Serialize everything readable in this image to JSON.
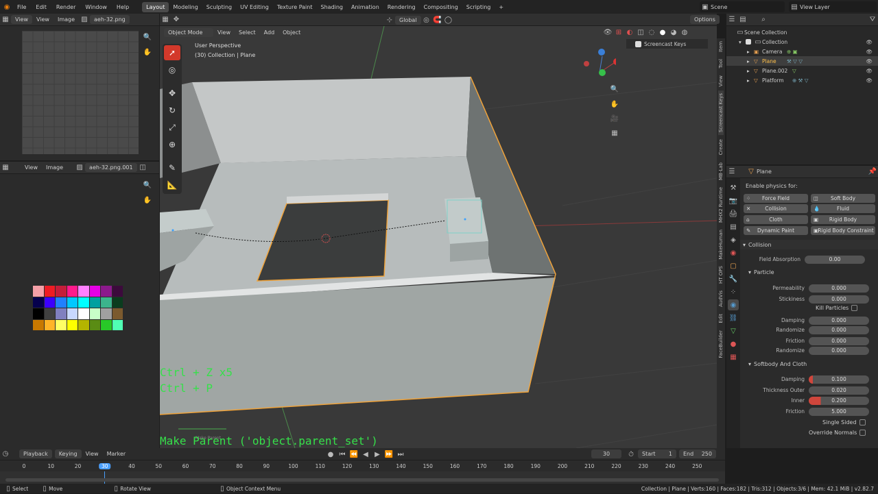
{
  "menus": [
    "File",
    "Edit",
    "Render",
    "Window",
    "Help"
  ],
  "workspaces": [
    "Layout",
    "Modeling",
    "Sculpting",
    "UV Editing",
    "Texture Paint",
    "Shading",
    "Animation",
    "Rendering",
    "Compositing",
    "Scripting",
    "+"
  ],
  "scene": {
    "name": "Scene",
    "view_layer": "View Layer"
  },
  "image_editor_top": {
    "view": "View",
    "menu_view": "View",
    "menu_image": "Image",
    "image_name": "aeh-32.png"
  },
  "image_editor_bottom": {
    "menu_view": "View",
    "menu_image": "Image",
    "image_name": "aeh-32.png.001"
  },
  "palette_colors": [
    "#f4a0a8",
    "#ee1c24",
    "#c41e3a",
    "#ff1a8c",
    "#ff80ff",
    "#e600e6",
    "#8c198c",
    "#3c0a3c",
    "#05004d",
    "#3c00ff",
    "#2080ff",
    "#00c8ff",
    "#00ffff",
    "#00a0a0",
    "#3cb48c",
    "#0a3c1e",
    "#000000",
    "#404040",
    "#8080c0",
    "#c8d8ff",
    "#ffffff",
    "#c8ffc8",
    "#a0a0a0",
    "#7b5a2e",
    "#c87800",
    "#ffb428",
    "#ffff64",
    "#ffff00",
    "#b4b400",
    "#5a8c14",
    "#28c828",
    "#50ffb4"
  ],
  "viewport": {
    "mode": "Object Mode",
    "menus": [
      "View",
      "Select",
      "Add",
      "Object"
    ],
    "orientation": "Global",
    "options": "Options",
    "perspective": "User Perspective",
    "collection_label": "(30) Collection | Plane",
    "screencast_keys": "Screencast Keys",
    "key_hint_1": "Ctrl + Z x5",
    "key_hint_2": "Ctrl + P",
    "operator": "Make Parent ('object.parent_set')",
    "operator_small": "Make Parent",
    "side_tabs": [
      "Item",
      "Tool",
      "View",
      "Screencast Keys",
      "Create",
      "MB-Lab",
      "MHX2 Runtime",
      "MakeHuman",
      "HT OPS",
      "AudVis",
      "Edit",
      "FaceBuilder"
    ]
  },
  "outliner": {
    "root": "Scene Collection",
    "collection": "Collection",
    "items": [
      "Camera",
      "Plane",
      "Plane.002",
      "Platform"
    ]
  },
  "properties": {
    "object_name": "Plane",
    "enable_label": "Enable physics for:",
    "buttons": [
      "Force Field",
      "Soft Body",
      "Collision",
      "Fluid",
      "Cloth",
      "Rigid Body",
      "Dynamic Paint",
      "Rigid Body Constraint"
    ],
    "collision_header": "Collision",
    "field_absorption_label": "Field Absorption",
    "field_absorption": "0.00",
    "particle_header": "Particle",
    "permeability_label": "Permeability",
    "permeability": "0.000",
    "stickiness_label": "Stickiness",
    "stickiness": "0.000",
    "kill_particles": "Kill Particles",
    "damping_label": "Damping",
    "damping": "0.000",
    "randomize_label": "Randomize",
    "randomize": "0.000",
    "friction_label": "Friction",
    "friction": "0.000",
    "randomize2_label": "Randomize",
    "randomize2": "0.000",
    "softbody_header": "Softbody And Cloth",
    "sb_damping_label": "Damping",
    "sb_damping": "0.100",
    "thickness_outer_label": "Thickness Outer",
    "thickness_outer": "0.020",
    "inner_label": "Inner",
    "inner": "0.200",
    "sb_friction_label": "Friction",
    "sb_friction": "5.000",
    "single_sided": "Single Sided",
    "override_normals": "Override Normals"
  },
  "timeline": {
    "playback": "Playback",
    "keying": "Keying",
    "view": "View",
    "marker": "Marker",
    "current_frame": "30",
    "start_label": "Start",
    "start": "1",
    "end_label": "End",
    "end": "250",
    "ticks": [
      "0",
      "10",
      "20",
      "30",
      "40",
      "50",
      "60",
      "70",
      "80",
      "90",
      "100",
      "110",
      "120",
      "130",
      "140",
      "150",
      "160",
      "170",
      "180",
      "190",
      "200",
      "210",
      "220",
      "230",
      "240",
      "250"
    ]
  },
  "statusbar": {
    "select": "Select",
    "move": "Move",
    "rotate": "Rotate View",
    "context": "Object Context Menu",
    "stats": "Collection | Plane | Verts:160 | Faces:182 | Tris:312 | Objects:3/6 | Mem: 42.1 MiB | v2.82.7"
  }
}
